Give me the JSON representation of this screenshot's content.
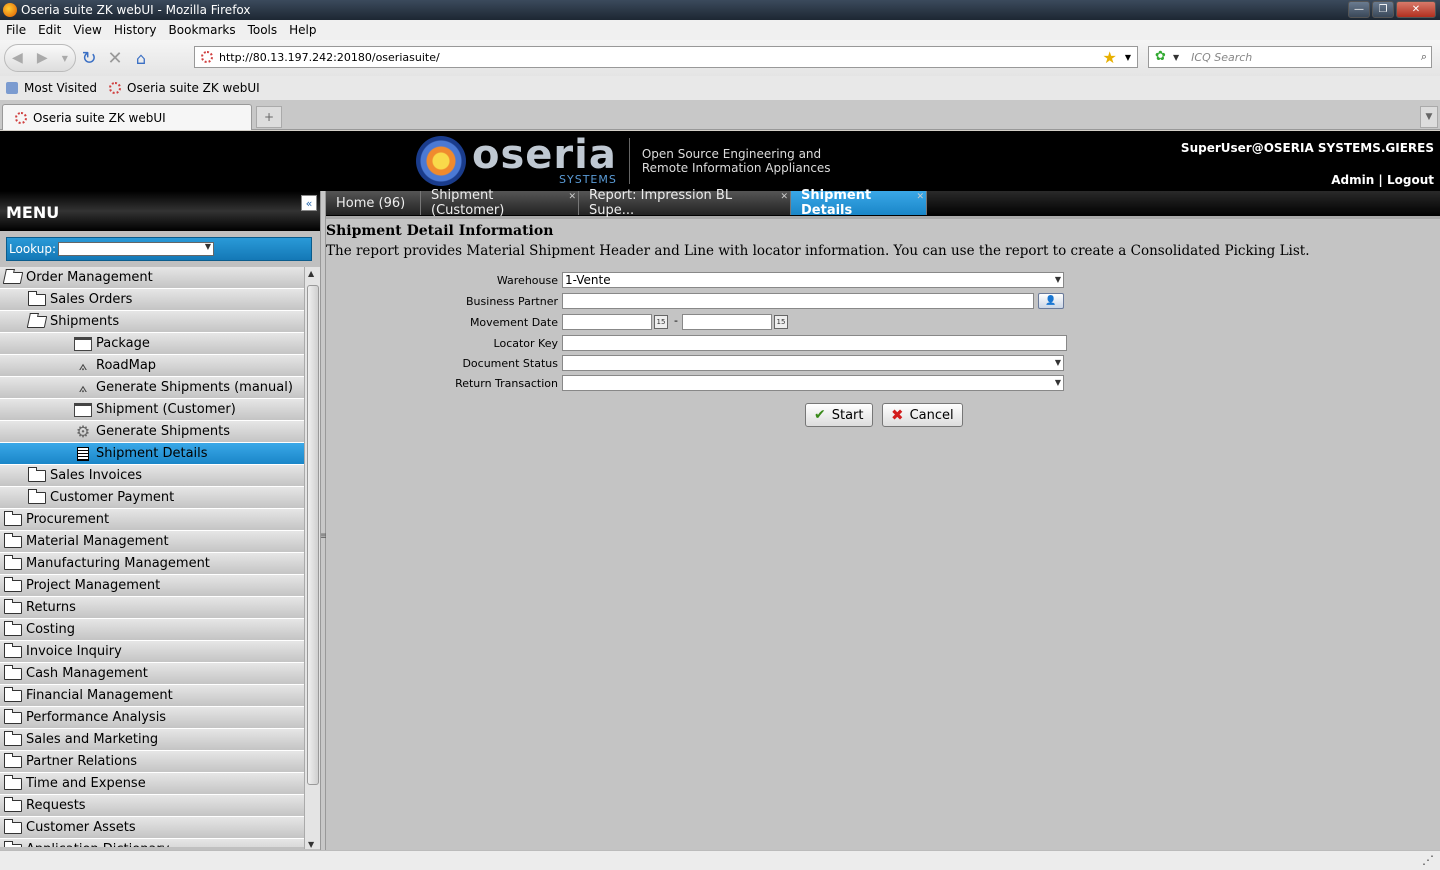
{
  "window": {
    "title": "Oseria suite ZK webUI - Mozilla Firefox"
  },
  "menubar": [
    "File",
    "Edit",
    "View",
    "History",
    "Bookmarks",
    "Tools",
    "Help"
  ],
  "nav": {
    "url": "http://80.13.197.242:20180/oseriasuite/",
    "search_placeholder": "ICQ Search"
  },
  "bookmarks": [
    "Most Visited",
    "Oseria suite ZK webUI"
  ],
  "browser_tab": {
    "label": "Oseria suite ZK webUI"
  },
  "app": {
    "logo_word": "oseria",
    "logo_sub": "SYSTEMS",
    "tagline1": "Open Source Engineering and",
    "tagline2": "Remote Information Appliances",
    "user": "SuperUser@OSERIA SYSTEMS.GIERES",
    "links": "Admin | Logout"
  },
  "menu": {
    "title": "MENU",
    "lookup_label": "Lookup:",
    "items": [
      {
        "label": "Order Management",
        "icon": "folder-open-icon",
        "indent": 0
      },
      {
        "label": "Sales Orders",
        "icon": "folder-icon",
        "indent": 1
      },
      {
        "label": "Shipments",
        "icon": "folder-open-icon",
        "indent": 1
      },
      {
        "label": "Package",
        "icon": "window-icon",
        "indent": 2
      },
      {
        "label": "RoadMap",
        "icon": "workflow-icon",
        "indent": 2
      },
      {
        "label": "Generate Shipments (manual)",
        "icon": "workflow-icon",
        "indent": 2
      },
      {
        "label": "Shipment (Customer)",
        "icon": "window-icon",
        "indent": 2
      },
      {
        "label": "Generate Shipments",
        "icon": "gear-icon",
        "indent": 2
      },
      {
        "label": "Shipment Details",
        "icon": "report-icon",
        "indent": 2,
        "selected": true
      },
      {
        "label": "Sales Invoices",
        "icon": "folder-icon",
        "indent": 1
      },
      {
        "label": "Customer Payment",
        "icon": "folder-icon",
        "indent": 1
      },
      {
        "label": "Procurement",
        "icon": "folder-icon",
        "indent": 0
      },
      {
        "label": "Material Management",
        "icon": "folder-icon",
        "indent": 0
      },
      {
        "label": "Manufacturing Management",
        "icon": "folder-icon",
        "indent": 0
      },
      {
        "label": "Project Management",
        "icon": "folder-icon",
        "indent": 0
      },
      {
        "label": "Returns",
        "icon": "folder-icon",
        "indent": 0
      },
      {
        "label": "Costing",
        "icon": "folder-icon",
        "indent": 0
      },
      {
        "label": "Invoice Inquiry",
        "icon": "folder-icon",
        "indent": 0
      },
      {
        "label": "Cash Management",
        "icon": "folder-icon",
        "indent": 0
      },
      {
        "label": "Financial Management",
        "icon": "folder-icon",
        "indent": 0
      },
      {
        "label": "Performance Analysis",
        "icon": "folder-icon",
        "indent": 0
      },
      {
        "label": "Sales and Marketing",
        "icon": "folder-icon",
        "indent": 0
      },
      {
        "label": "Partner Relations",
        "icon": "folder-icon",
        "indent": 0
      },
      {
        "label": "Time and Expense",
        "icon": "folder-icon",
        "indent": 0
      },
      {
        "label": "Requests",
        "icon": "folder-icon",
        "indent": 0
      },
      {
        "label": "Customer Assets",
        "icon": "folder-icon",
        "indent": 0
      },
      {
        "label": "Application Dictionary",
        "icon": "folder-icon",
        "indent": 0
      }
    ]
  },
  "tabs": [
    {
      "label": "Home (96)"
    },
    {
      "label": "Shipment (Customer)"
    },
    {
      "label": "Report: Impression BL Supe..."
    },
    {
      "label": "Shipment Details",
      "active": true
    }
  ],
  "report": {
    "title": "Shipment Detail Information",
    "description": "The report provides Material Shipment Header and Line with locator information. You can use the report to create a Consolidated Picking List.",
    "fields": {
      "warehouse": {
        "label": "Warehouse",
        "value": "1-Vente"
      },
      "business_partner": {
        "label": "Business Partner",
        "value": ""
      },
      "movement_date": {
        "label": "Movement Date",
        "from": "",
        "to": "",
        "separator": "-"
      },
      "locator_key": {
        "label": "Locator Key",
        "value": ""
      },
      "document_status": {
        "label": "Document Status",
        "value": ""
      },
      "return_transaction": {
        "label": "Return Transaction",
        "value": ""
      }
    },
    "start_label": "Start",
    "cancel_label": "Cancel"
  },
  "colors": {
    "accent": "#1a86c8",
    "header_bg": "#000000"
  }
}
